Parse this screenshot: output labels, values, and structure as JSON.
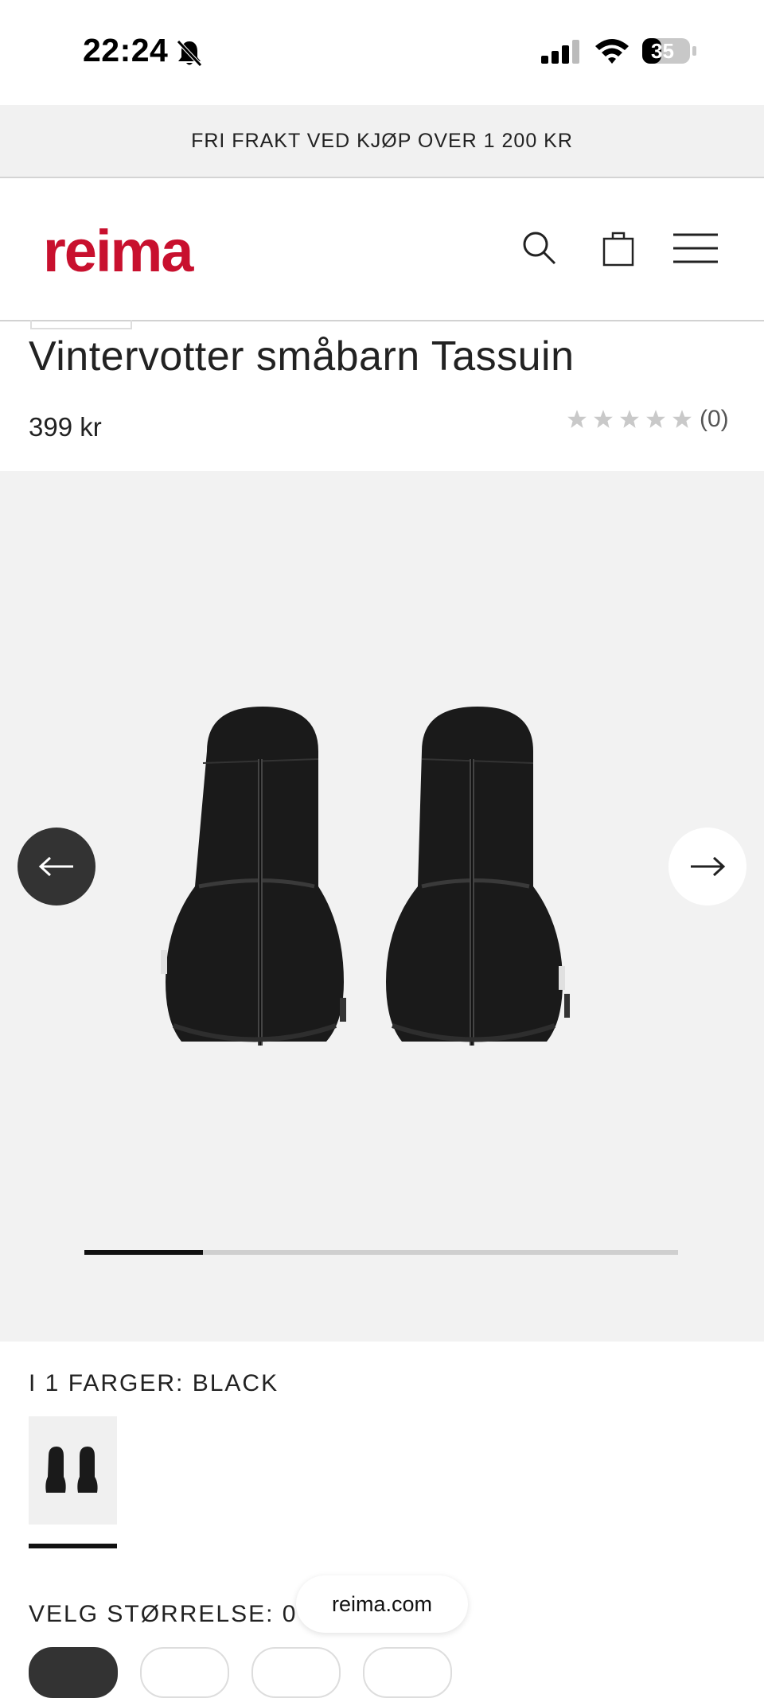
{
  "status_bar": {
    "time": "22:24",
    "battery": "35",
    "icons": [
      "bell-slash-icon",
      "cellular-signal-icon",
      "wifi-icon",
      "battery-icon"
    ]
  },
  "promo": {
    "text": "FRI FRAKT VED KJØP OVER 1 200 KR"
  },
  "header": {
    "logo": "reima",
    "icons": [
      "search-icon",
      "shopping-bag-icon",
      "hamburger-menu-icon"
    ]
  },
  "product": {
    "title": "Vintervotter småbarn Tassuin",
    "price": "399 kr",
    "rating": {
      "stars": 0,
      "max_stars": 5,
      "count": "(0)"
    }
  },
  "gallery": {
    "progress_fraction": 0.2,
    "prev_icon": "arrow-left-icon",
    "next_icon": "arrow-right-icon"
  },
  "colors": {
    "label": "I 1 FARGER: BLACK",
    "selected": "BLACK"
  },
  "size": {
    "label": "VELG STØRRELSE: 0"
  },
  "browser": {
    "url": "reima.com"
  },
  "theme": {
    "brand": "#c8102e",
    "gallery_bg": "#f2f2f2",
    "text": "#222222"
  }
}
